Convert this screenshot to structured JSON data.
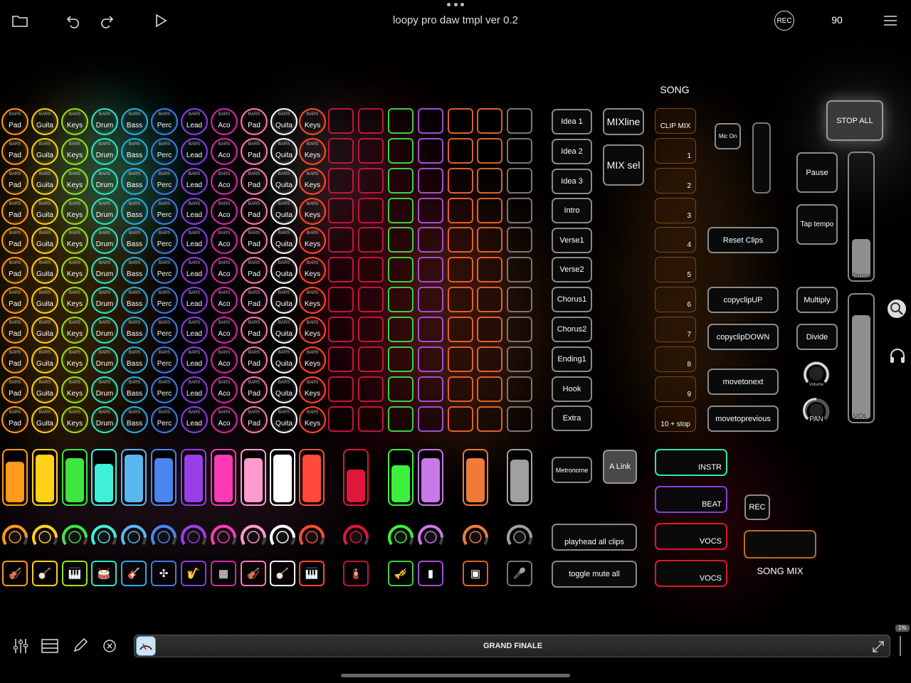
{
  "app": {
    "title": "loopy pro daw tmpl ver 0.2",
    "rec_label": "REC",
    "bpm": "90"
  },
  "icons": [
    "folder-icon",
    "undo-icon",
    "redo-icon",
    "play-icon",
    "menu-icon"
  ],
  "pad_grid": {
    "columns": [
      {
        "label": "Pad",
        "color": "#ff9a1a"
      },
      {
        "label": "Guita",
        "color": "#ffd21a"
      },
      {
        "label": "Keys",
        "color": "#9be21a"
      },
      {
        "label": "Drum",
        "color": "#2ee6c8"
      },
      {
        "label": "Bass",
        "color": "#2aaee8"
      },
      {
        "label": "Perc",
        "color": "#3f7ce8"
      },
      {
        "label": "Lead",
        "color": "#8a3ee0"
      },
      {
        "label": "Aco",
        "color": "#d52aa8"
      },
      {
        "label": "Pad",
        "color": "#ff7ab8"
      },
      {
        "label": "Quita",
        "color": "#ffffff"
      },
      {
        "label": "Keys",
        "color": "#ff4a2a"
      }
    ],
    "sublabel": "BARS",
    "rows": 11
  },
  "square_grid": {
    "columns": [
      "#c0163a",
      "#c0163a",
      "#3ed13e",
      "#a24fd6",
      "#e0602a",
      "#e0602a",
      "#777777"
    ],
    "rows": 11
  },
  "sections": {
    "song_label": "SONG",
    "song_slots": [
      "CLIP MIX",
      "1",
      "2",
      "3",
      "4",
      "5",
      "6",
      "7",
      "8",
      "9",
      "10 + stop"
    ],
    "song_parts": [
      "Idea 1",
      "Idea 2",
      "Idea 3",
      "Intro",
      "Verse1",
      "Verse2",
      "Chorus1",
      "Chorus2",
      "Ending1",
      "Hook",
      "Extra"
    ],
    "mixline": "MIXline",
    "mixsel": "MIX sel",
    "mic_on": "Mic On",
    "stop_all": "STOP ALL",
    "pause": "Pause",
    "tap_tempo": "Tap tempo",
    "reset_clips": "Reset Clips",
    "copyclip_up": "copyclipUP",
    "copyclip_down": "copyclipDOWN",
    "multiply": "Multiply",
    "divide": "Divide",
    "movetonext": "movetonext",
    "movetoprevious": "movetoprevious",
    "tempo_label": "Tempo",
    "vol_label": "VOL",
    "volume_label": "Volume",
    "pan_label": "PAN",
    "metronome": "Metronome",
    "alink": "A Link",
    "playhead_all": "playhead all clips",
    "toggle_mute": "toggle mute all",
    "instr": "INSTR",
    "beat": "BEAT",
    "vocs1": "VOCS",
    "vocs2": "VOCS",
    "rec": "REC",
    "song_mix": "SONG MIX"
  },
  "faders": [
    {
      "color": "#ff9a1a",
      "level": 0.82
    },
    {
      "color": "#ffd21a",
      "level": 0.95
    },
    {
      "color": "#3ee63e",
      "level": 0.88
    },
    {
      "color": "#3ef0d8",
      "level": 0.77
    },
    {
      "color": "#5ab8f0",
      "level": 0.95
    },
    {
      "color": "#4a86f0",
      "level": 0.88
    },
    {
      "color": "#9a3ee8",
      "level": 0.95
    },
    {
      "color": "#ff3ab8",
      "level": 0.95
    },
    {
      "color": "#ff9ad0",
      "level": 0.88
    },
    {
      "color": "#ffffff",
      "level": 0.95
    },
    {
      "color": "#ff4a3a",
      "level": 0.95
    },
    {
      "color": "#e0163a",
      "level": 0.65
    },
    {
      "color": "#3ef03e",
      "level": 0.74
    },
    {
      "color": "#c878e8",
      "level": 0.88
    },
    {
      "color": "#f07a3a",
      "level": 0.88
    },
    {
      "color": "#a0a0a0",
      "level": 0.85
    }
  ],
  "instrument_icons": [
    {
      "name": "violin-icon",
      "glyph": "🎻",
      "color": "#ff9a1a"
    },
    {
      "name": "banjo-icon",
      "glyph": "🪕",
      "color": "#ffd21a"
    },
    {
      "name": "piano-icon",
      "glyph": "🎹",
      "color": "#9be21a"
    },
    {
      "name": "drum-icon",
      "glyph": "🥁",
      "color": "#2ee6c8"
    },
    {
      "name": "guitar-icon",
      "glyph": "🎸",
      "color": "#2aaee8"
    },
    {
      "name": "maracas-icon",
      "glyph": "✣",
      "color": "#3f7ce8"
    },
    {
      "name": "saxophone-icon",
      "glyph": "🎷",
      "color": "#8a3ee0"
    },
    {
      "name": "accordion-icon",
      "glyph": "▦",
      "color": "#d52aa8"
    },
    {
      "name": "violin-icon",
      "glyph": "🎻",
      "color": "#ff7ab8"
    },
    {
      "name": "banjo-icon",
      "glyph": "🪕",
      "color": "#ffffff"
    },
    {
      "name": "piano-icon",
      "glyph": "🎹",
      "color": "#ff4a2a"
    },
    {
      "name": "fire-extinguisher-icon",
      "glyph": "🧯",
      "color": "#c0163a"
    },
    {
      "name": "trumpet-icon",
      "glyph": "🎺",
      "color": "#3ed13e"
    },
    {
      "name": "conga-icon",
      "glyph": "▮",
      "color": "#a24fd6"
    },
    {
      "name": "drum-machine-icon",
      "glyph": "▣",
      "color": "#e0602a"
    },
    {
      "name": "microphone-icon",
      "glyph": "🎤",
      "color": "#777777"
    }
  ],
  "bottom": {
    "preset": "GRAND FINALE",
    "percent": "1%"
  }
}
